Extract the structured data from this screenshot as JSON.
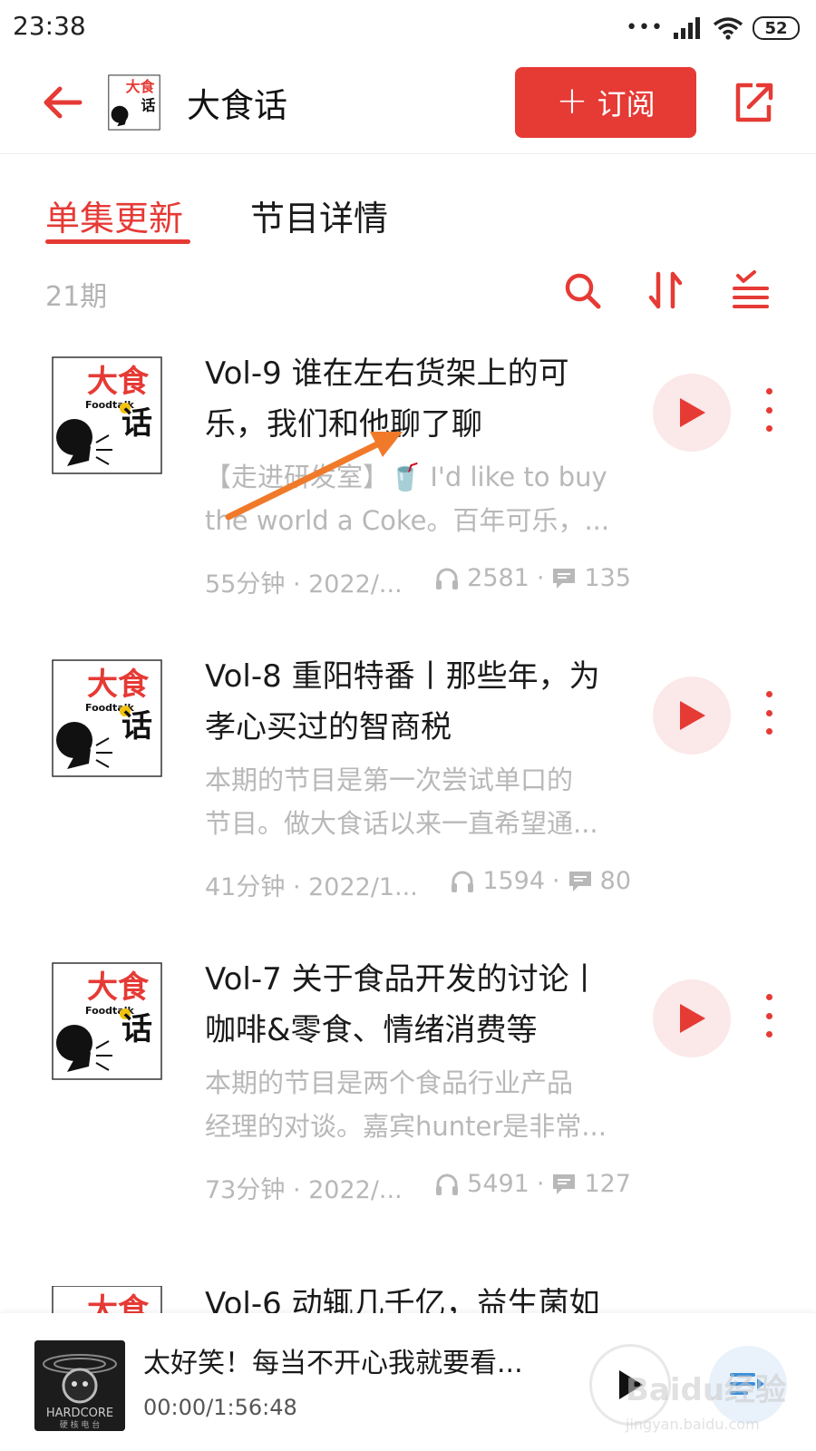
{
  "status_bar": {
    "time": "23:38",
    "signal_dots": "•••",
    "battery": "52"
  },
  "header": {
    "podcast_title": "大食话",
    "subscribe_label": "订阅",
    "subscribe_plus": "+"
  },
  "tabs": [
    {
      "label": "单集更新"
    },
    {
      "label": "节目详情"
    }
  ],
  "toolbar": {
    "episode_count": "21期",
    "icons": [
      "search-icon",
      "sort-icon",
      "filter-list-icon"
    ]
  },
  "episodes": [
    {
      "title_line1": "Vol-9 谁在左右货架上的可",
      "title_line2": "乐，我们和他聊了聊",
      "desc_line1": "【走进研发室】🥤 I'd like to buy",
      "desc_line2": "the world a Coke。百年可乐，...",
      "duration_date": "55分钟 · 2022/...",
      "plays": "2581",
      "comments": "135"
    },
    {
      "title_line1": "Vol-8 重阳特番丨那些年，为",
      "title_line2": "孝心买过的智商税",
      "desc_line1": "本期的节目是第一次尝试单口的",
      "desc_line2": "节目。做大食话以来一直希望通...",
      "duration_date": "41分钟 · 2022/1...",
      "plays": "1594",
      "comments": "80"
    },
    {
      "title_line1": "Vol-7 关于食品开发的讨论丨",
      "title_line2": "咖啡&零食、情绪消费等",
      "desc_line1": "本期的节目是两个食品行业产品",
      "desc_line2": "经理的对谈。嘉宾hunter是非常...",
      "duration_date": "73分钟 · 2022/...",
      "plays": "5491",
      "comments": "127"
    }
  ],
  "partial_episode": {
    "title": "Vol-6 动辄几千亿，益生菌如"
  },
  "cover_art": {
    "brand_cn": "大食话",
    "brand_en": "Foodtalk"
  },
  "mini_player": {
    "title": "太好笑！每当不开心我就要看...",
    "time": "00:00/1:56:48",
    "cover_text": "HARDCORE",
    "cover_sub": "硬 核 电 台"
  },
  "watermark": {
    "line1": "Baidu经验",
    "line2": "jingyan.baidu.com"
  },
  "colors": {
    "accent": "#e63a35",
    "play_bg": "#fbe8e8",
    "muted_text": "#b8b8b8",
    "annotation_arrow": "#f07a2a"
  }
}
